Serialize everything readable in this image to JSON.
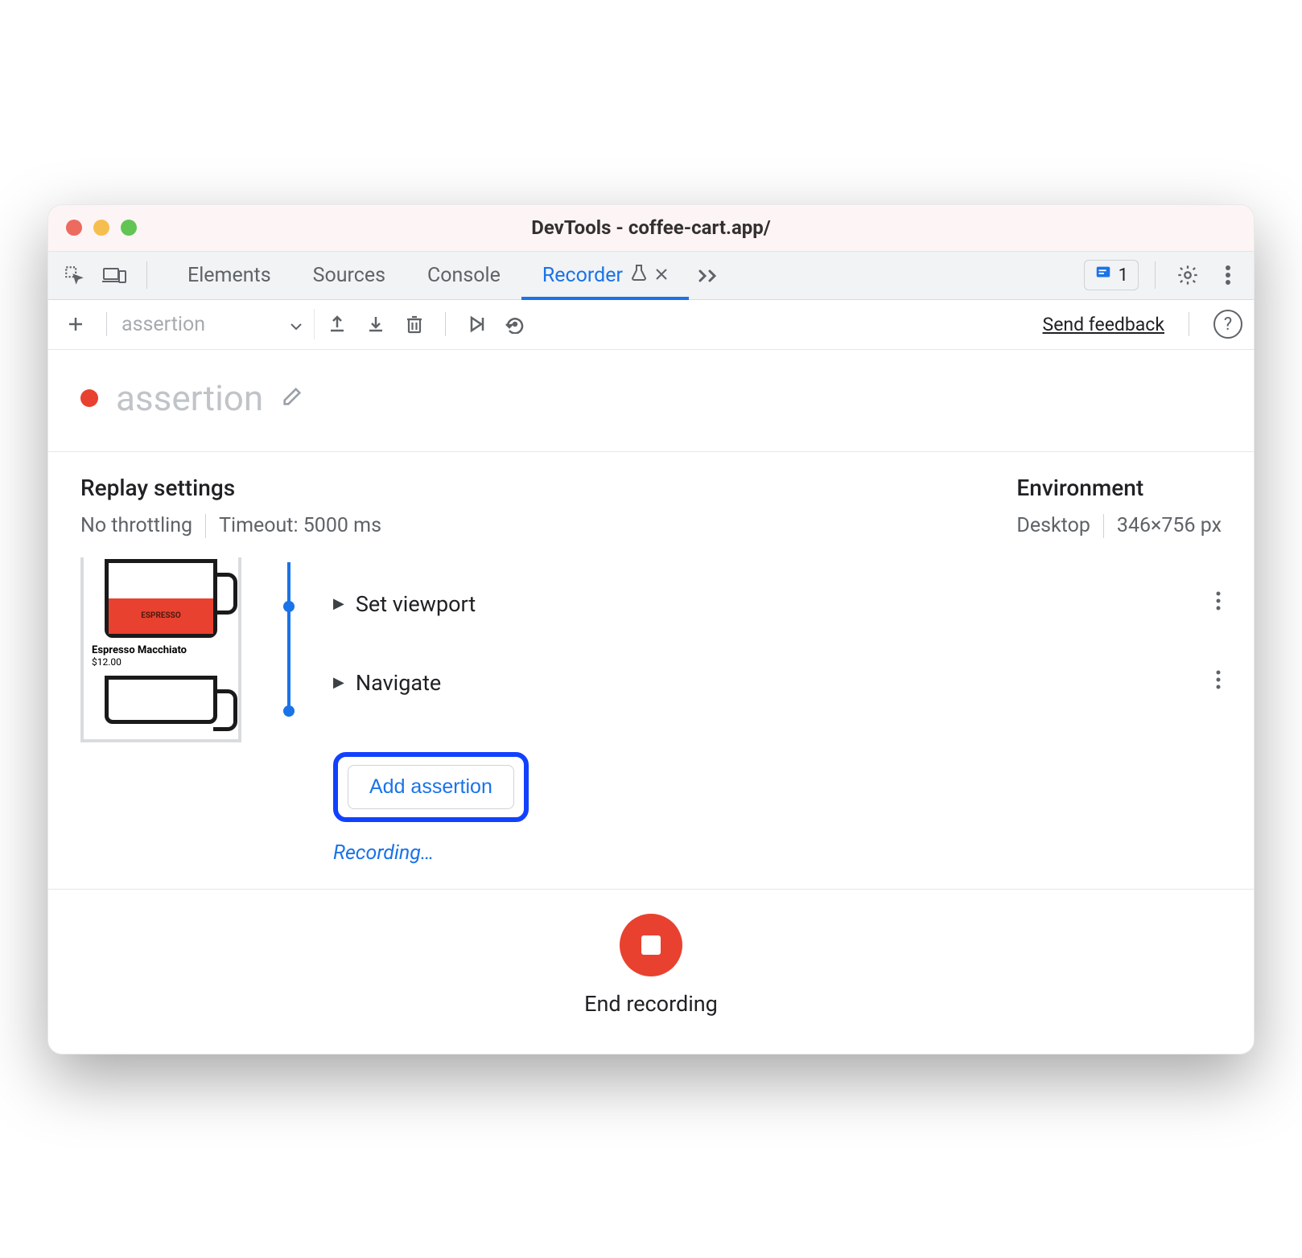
{
  "window": {
    "title": "DevTools - coffee-cart.app/"
  },
  "tabs": {
    "items": [
      "Elements",
      "Sources",
      "Console",
      "Recorder"
    ],
    "active": "Recorder"
  },
  "issues": {
    "count": "1"
  },
  "toolbar": {
    "recording_name": "assertion",
    "send_feedback": "Send feedback"
  },
  "recording": {
    "title": "assertion"
  },
  "settings": {
    "replay_heading": "Replay settings",
    "throttling": "No throttling",
    "timeout": "Timeout: 5000 ms",
    "env_heading": "Environment",
    "device": "Desktop",
    "viewport": "346×756 px"
  },
  "preview": {
    "product_name": "Espresso Macchiato",
    "product_price": "$12.00",
    "fill_label": "ESPRESSO"
  },
  "steps": [
    {
      "label": "Set viewport"
    },
    {
      "label": "Navigate"
    }
  ],
  "add_assertion_label": "Add assertion",
  "recording_status": "Recording…",
  "footer": {
    "end_label": "End recording"
  }
}
